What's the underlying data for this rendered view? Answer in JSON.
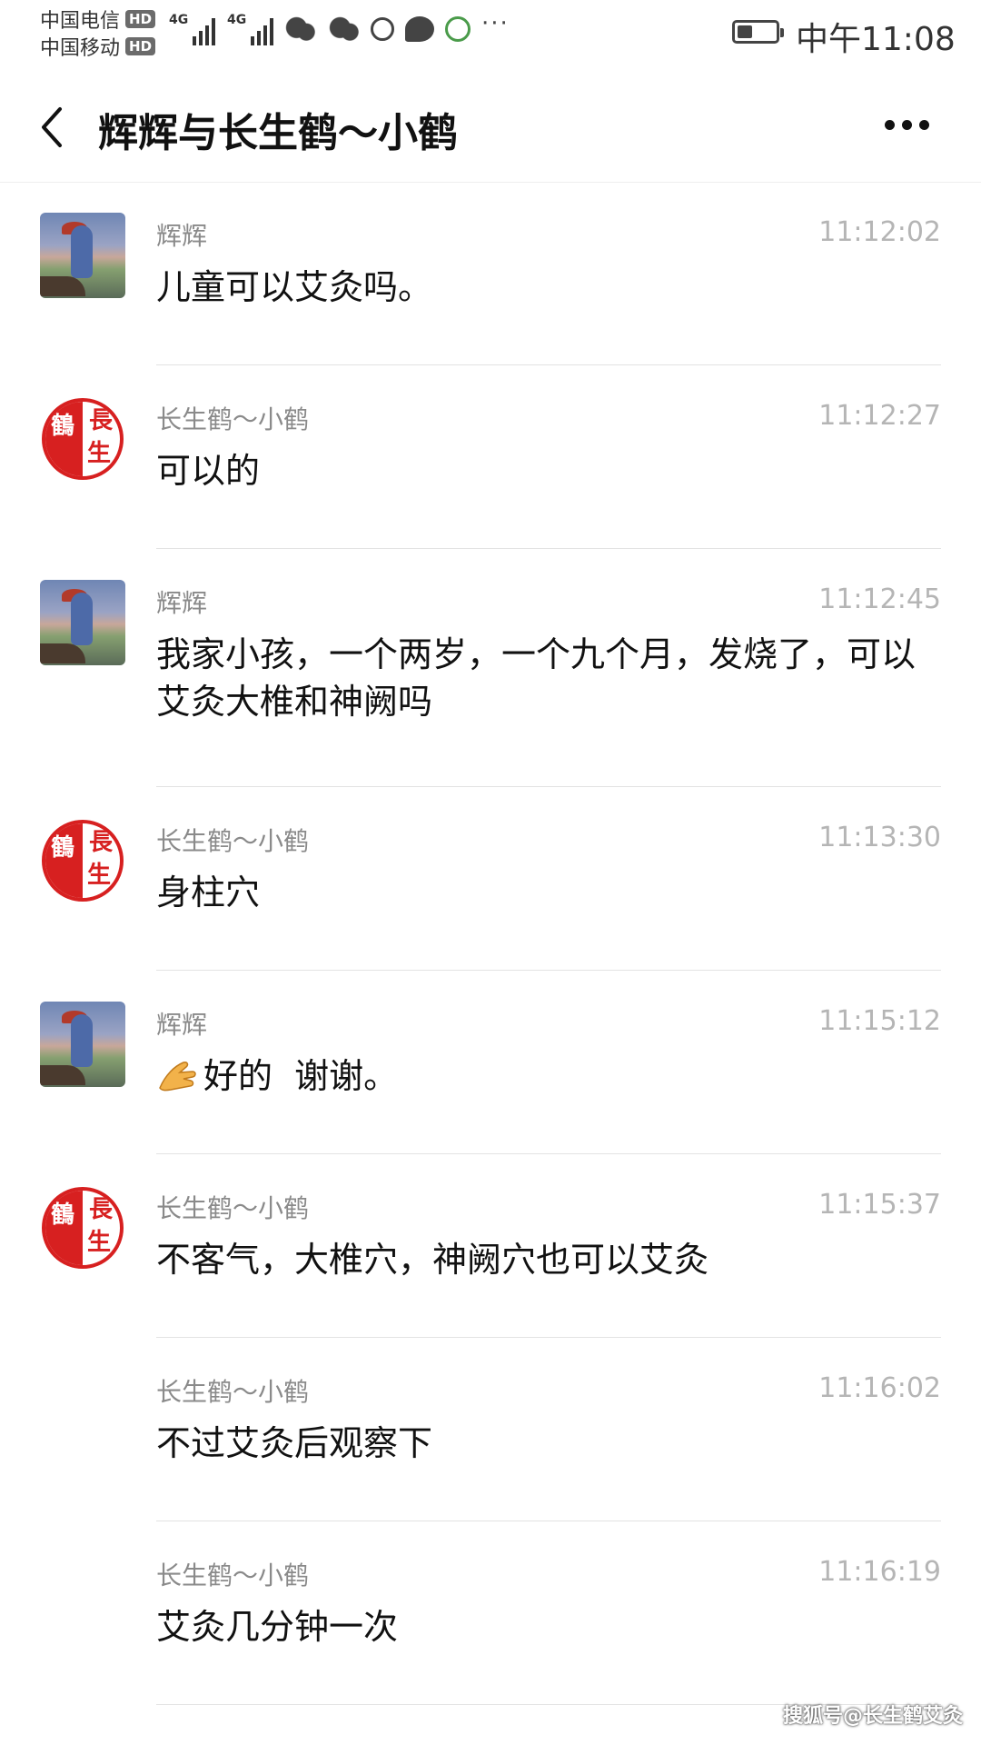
{
  "status_bar": {
    "carrier1": "中国电信",
    "carrier2": "中国移动",
    "hd": "HD",
    "network_tag": "4G",
    "icons": [
      "wechat-icon",
      "wechat-icon",
      "alarm-icon",
      "message-icon",
      "green-app-icon",
      "more-notifications-icon"
    ],
    "more": "···",
    "battery_level": 0.4,
    "time": "中午11:08"
  },
  "header": {
    "title": "辉辉与长生鹤～小鹤"
  },
  "messages": [
    {
      "sender": "辉辉",
      "avatar": "cartoon-cat-avatar",
      "time": "11:12:02",
      "text": "儿童可以艾灸吗。"
    },
    {
      "sender": "长生鹤～小鹤",
      "avatar": "red-seal-avatar",
      "time": "11:12:27",
      "text": "可以的"
    },
    {
      "sender": "辉辉",
      "avatar": "cartoon-cat-avatar",
      "time": "11:12:45",
      "text": "我家小孩，一个两岁，一个九个月，发烧了，可以艾灸大椎和神阙吗"
    },
    {
      "sender": "长生鹤～小鹤",
      "avatar": "red-seal-avatar",
      "time": "11:13:30",
      "text": "身柱穴"
    },
    {
      "sender": "辉辉",
      "avatar": "cartoon-cat-avatar",
      "time": "11:15:12",
      "text": "好的  谢谢。",
      "emoji": "ok-hand-emoji"
    },
    {
      "sender": "长生鹤～小鹤",
      "avatar": "red-seal-avatar",
      "time": "11:15:37",
      "text": "不客气，大椎穴，神阙穴也可以艾灸"
    },
    {
      "sender": "长生鹤～小鹤",
      "time": "11:16:02",
      "text": "不过艾灸后观察下"
    },
    {
      "sender": "长生鹤～小鹤",
      "time": "11:16:19",
      "text": "艾灸几分钟一次"
    }
  ],
  "seal": {
    "chars": [
      "鶴",
      "長",
      "生"
    ]
  },
  "watermark": "搜狐号@长生鹤艾灸"
}
